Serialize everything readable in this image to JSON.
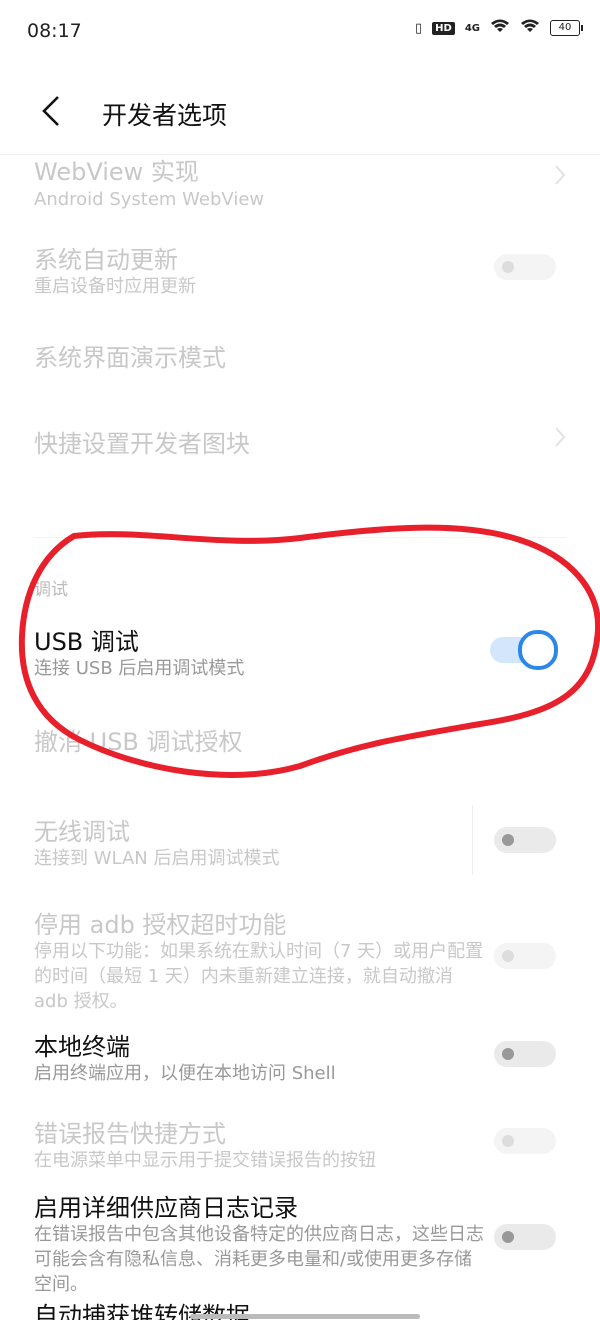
{
  "status": {
    "time": "08:17",
    "hd": "HD",
    "signal": "4G",
    "battery": "40"
  },
  "header": {
    "title": "开发者选项"
  },
  "items": {
    "webview": {
      "title": "WebView 实现",
      "subtitle": "Android System WebView"
    },
    "auto_update": {
      "title": "系统自动更新",
      "subtitle": "重启设备时应用更新",
      "toggle_on": false
    },
    "demo_mode": {
      "title": "系统界面演示模式"
    },
    "quick_tiles": {
      "title": "快捷设置开发者图块"
    },
    "section_debug": "调试",
    "usb_debug": {
      "title": "USB 调试",
      "subtitle": "连接 USB 后启用调试模式",
      "toggle_on": true
    },
    "revoke_usb": {
      "title": "撤消 USB 调试授权"
    },
    "wireless_debug": {
      "title": "无线调试",
      "subtitle": "连接到 WLAN 后启用调试模式",
      "toggle_on": false
    },
    "adb_timeout": {
      "title": "停用 adb 授权超时功能",
      "subtitle": "停用以下功能：如果系统在默认时间（7 天）或用户配置的时间（最短 1 天）内未重新建立连接，就自动撤消 adb 授权。",
      "toggle_on": false
    },
    "local_terminal": {
      "title": "本地终端",
      "subtitle": "启用终端应用，以便在本地访问 Shell",
      "toggle_on": false
    },
    "bug_report": {
      "title": "错误报告快捷方式",
      "subtitle": "在电源菜单中显示用于提交错误报告的按钮",
      "toggle_on": false
    },
    "vendor_log": {
      "title": "启用详细供应商日志记录",
      "subtitle": "在错误报告中包含其他设备特定的供应商日志，这些日志可能会含有隐私信息、消耗更多电量和/或使用更多存储空间。",
      "toggle_on": false
    },
    "heap_dump": {
      "title": "自动捕获堆转储数据"
    }
  },
  "colors": {
    "accent": "#2c87e6",
    "annotation": "#e8202c"
  }
}
